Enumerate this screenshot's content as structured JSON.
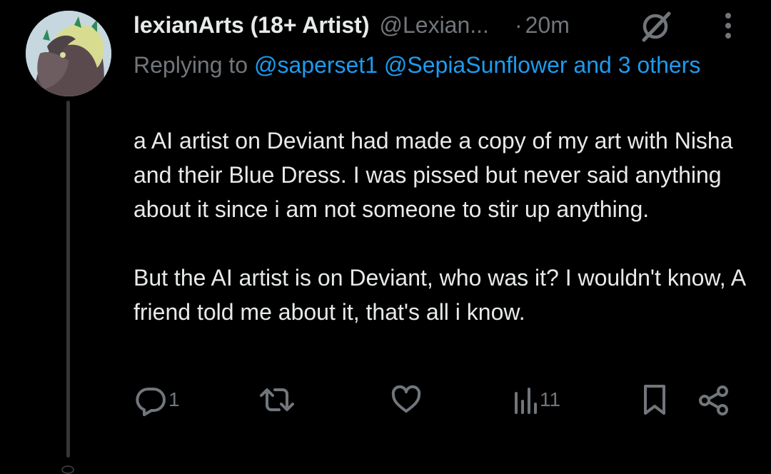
{
  "tweet": {
    "author_name": "lexianArts (18+ Artist)",
    "author_handle": "@Lexian...",
    "separator": "·",
    "time": "20m",
    "reply_prefix": "Replying to",
    "reply_mentions": "@saperset1 @SepiaSunflower and 3 others",
    "body_paragraphs": [
      "a AI artist on Deviant had made a copy of my art with Nisha and their Blue Dress. I was pissed but never said anything about it since i am not someone to stir up anything.",
      "But the AI artist is on Deviant, who was it? I wouldn't know, A friend told me about it, that's all i know."
    ]
  },
  "actions": {
    "reply_count": "1",
    "retweet_count": "",
    "like_count": "",
    "view_count": "11"
  },
  "icons": [
    "avatar",
    "badge-icon",
    "more-icon",
    "reply-icon",
    "retweet-icon",
    "like-icon",
    "views-icon",
    "bookmark-icon",
    "share-icon"
  ],
  "colors": {
    "background": "#000000",
    "text": "#e7e9ea",
    "muted": "#71767b",
    "link": "#1d9bf0"
  }
}
